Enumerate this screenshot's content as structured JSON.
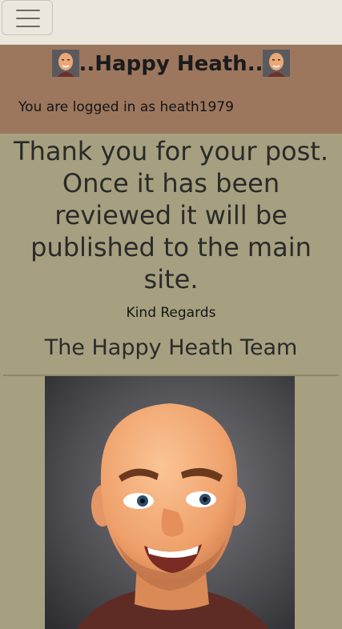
{
  "nav": {
    "menu_icon": "hamburger-menu-icon"
  },
  "header": {
    "title": "..Happy Heath..",
    "logged_in_text": "You are logged in as heath1979"
  },
  "main": {
    "message": "Thank you for your post. Once it has been reviewed it will be published to the main site.",
    "regards": "Kind Regards",
    "team": "The Happy Heath Team"
  },
  "colors": {
    "topbar": "#ebe7dc",
    "header": "#9c775e",
    "page": "#a6a080"
  }
}
